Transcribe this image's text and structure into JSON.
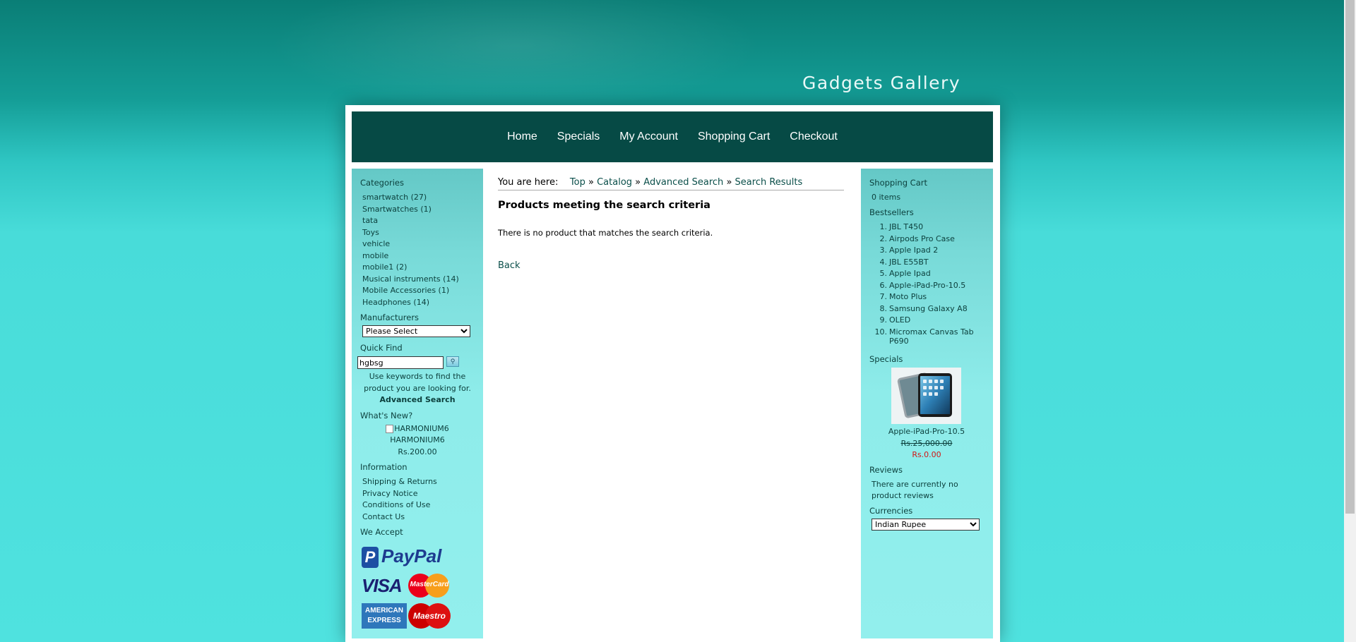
{
  "site": {
    "title": "Gadgets Gallery"
  },
  "nav": {
    "items": [
      {
        "label": "Home"
      },
      {
        "label": "Specials"
      },
      {
        "label": "My Account"
      },
      {
        "label": "Shopping Cart"
      },
      {
        "label": "Checkout"
      }
    ]
  },
  "left": {
    "categories_heading": "Categories",
    "categories": [
      "smartwatch (27)",
      "Smartwatches (1)",
      "tata",
      "Toys",
      "vehicle",
      "mobile",
      "mobile1 (2)",
      "Musical instruments (14)",
      "Mobile Accessories (1)",
      "Headphones (14)"
    ],
    "manufacturers_heading": "Manufacturers",
    "manufacturers_selected": "Please Select",
    "quickfind_heading": "Quick Find",
    "search_value": "hgbsg",
    "search_hint_line1": "Use keywords to find the",
    "search_hint_line2": "product you are looking for.",
    "advanced_search": "Advanced Search",
    "whatsnew_heading": "What's New?",
    "whatsnew_img_alt": "HARMONIUM6",
    "whatsnew_name": "HARMONIUM6",
    "whatsnew_price": "Rs.200.00",
    "information_heading": "Information",
    "information": [
      "Shipping & Returns",
      "Privacy Notice",
      "Conditions of Use",
      "Contact Us"
    ],
    "weaccept_heading": "We Accept",
    "paypal_label": "PayPal",
    "visa_label": "VISA",
    "mastercard_label": "MasterCard",
    "amex_line1": "AMERICAN",
    "amex_line2": "EXPRESS",
    "maestro_label": "Maestro"
  },
  "main": {
    "breadcrumb_prefix": "You are here:",
    "breadcrumb": [
      "Top",
      "Catalog",
      "Advanced Search",
      "Search Results"
    ],
    "breadcrumb_sep": "»",
    "heading": "Products meeting the search criteria",
    "message": "There is no product that matches the search criteria.",
    "back": "Back"
  },
  "right": {
    "cart_heading": "Shopping Cart",
    "cart_items": "0 items",
    "bestsellers_heading": "Bestsellers",
    "bestsellers": [
      {
        "num": "1.",
        "name": "JBL T450"
      },
      {
        "num": "2.",
        "name": "Airpods Pro Case"
      },
      {
        "num": "3.",
        "name": "Apple Ipad 2"
      },
      {
        "num": "4.",
        "name": "JBL E55BT"
      },
      {
        "num": "5.",
        "name": "Apple Ipad"
      },
      {
        "num": "6.",
        "name": "Apple-iPad-Pro-10.5"
      },
      {
        "num": "7.",
        "name": "Moto Plus"
      },
      {
        "num": "8.",
        "name": "Samsung Galaxy A8"
      },
      {
        "num": "9.",
        "name": "OLED"
      },
      {
        "num": "10.",
        "name": "Micromax Canvas Tab P690"
      }
    ],
    "specials_heading": "Specials",
    "special_name": "Apple-iPad-Pro-10.5",
    "special_old_price": "Rs.25,000.00",
    "special_new_price": "Rs.0.00",
    "reviews_heading": "Reviews",
    "reviews_text_line1": "There are currently no",
    "reviews_text_line2": "product reviews",
    "currencies_heading": "Currencies",
    "currency_selected": "Indian Rupee"
  }
}
